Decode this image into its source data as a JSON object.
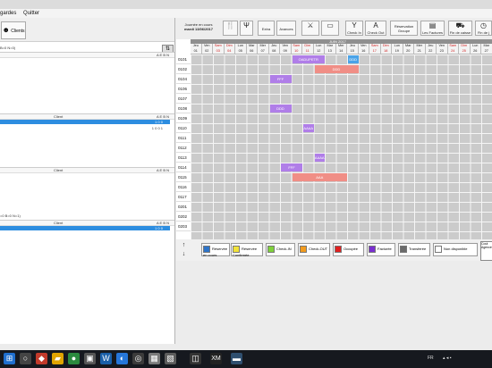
{
  "menu": {
    "items": [
      "gardes",
      "Quitter"
    ]
  },
  "left": {
    "client_button": "Clients",
    "toggle_icon": "swap-icon",
    "section1_label": "B=0 N=0)",
    "section_head_client": "Client",
    "section_head_flags": "A E B N",
    "sel_row_flags": "1 0 0",
    "plain_row_flags": "1 0 0 1",
    "section3_label": "=0 B=0 N=1)",
    "sel_row3_flags": "1 0 0"
  },
  "toolbar": {
    "day_title": "Journée en cours",
    "day_date": "mardi 13/06/2017",
    "extra": "Extra",
    "avances": "Avances",
    "check_in": "Check In",
    "check_out": "Check Out",
    "reservation_groupe": "Réservation Groupe",
    "les_factures": "Les Factures",
    "fin_caisse": "Fin de caisse",
    "fin_journee": "Fin de j"
  },
  "grid": {
    "month": "JUIN 2017",
    "days": [
      {
        "n": "Jeu",
        "d": "01",
        "we": false
      },
      {
        "n": "Ven",
        "d": "02",
        "we": false
      },
      {
        "n": "Sam",
        "d": "03",
        "we": true
      },
      {
        "n": "Dim",
        "d": "04",
        "we": true
      },
      {
        "n": "Lun",
        "d": "05",
        "we": false
      },
      {
        "n": "Mar",
        "d": "06",
        "we": false
      },
      {
        "n": "Mer",
        "d": "07",
        "we": false
      },
      {
        "n": "Jeu",
        "d": "08",
        "we": false
      },
      {
        "n": "Ven",
        "d": "09",
        "we": false
      },
      {
        "n": "Sam",
        "d": "10",
        "we": true
      },
      {
        "n": "Dim",
        "d": "11",
        "we": true
      },
      {
        "n": "Lun",
        "d": "12",
        "we": false
      },
      {
        "n": "Mar",
        "d": "13",
        "we": false
      },
      {
        "n": "Mer",
        "d": "14",
        "we": false
      },
      {
        "n": "Jeu",
        "d": "15",
        "we": false
      },
      {
        "n": "Ven",
        "d": "16",
        "we": false
      },
      {
        "n": "Sam",
        "d": "17",
        "we": true
      },
      {
        "n": "Dim",
        "d": "18",
        "we": true
      },
      {
        "n": "Lun",
        "d": "19",
        "we": false
      },
      {
        "n": "Mar",
        "d": "20",
        "we": false
      },
      {
        "n": "Mer",
        "d": "21",
        "we": false
      },
      {
        "n": "Jeu",
        "d": "22",
        "we": false
      },
      {
        "n": "Ven",
        "d": "23",
        "we": false
      },
      {
        "n": "Sam",
        "d": "24",
        "we": true
      },
      {
        "n": "Dim",
        "d": "25",
        "we": true
      },
      {
        "n": "Lun",
        "d": "26",
        "we": false
      },
      {
        "n": "Mar",
        "d": "27",
        "we": false
      }
    ],
    "rooms": [
      "0101",
      "0102",
      "0104",
      "0106",
      "0107",
      "0108",
      "0109",
      "0110",
      "0111",
      "0112",
      "0113",
      "0114",
      "0115",
      "0116",
      "0117",
      "0201",
      "0202",
      "0203"
    ],
    "reservations": [
      {
        "room": "0101",
        "start": "10",
        "end": "12",
        "label": "OADUPETR",
        "color": "#b07ee8"
      },
      {
        "room": "0101",
        "start": "15",
        "end": "15",
        "label": "DDD",
        "color": "#4aa3e8"
      },
      {
        "room": "0102",
        "start": "12",
        "end": "15",
        "label": "DDD",
        "color": "#f08e86"
      },
      {
        "room": "0104",
        "start": "08",
        "end": "09",
        "label": "FFF",
        "color": "#b07ee8"
      },
      {
        "room": "0108",
        "start": "08",
        "end": "09",
        "label": "DDD",
        "color": "#b07ee8"
      },
      {
        "room": "0110",
        "start": "11",
        "end": "11",
        "label": "AAAA",
        "color": "#b07ee8"
      },
      {
        "room": "0113",
        "start": "12",
        "end": "12",
        "label": "AAAA",
        "color": "#b07ee8"
      },
      {
        "room": "0114",
        "start": "09",
        "end": "10",
        "label": "FFF",
        "color": "#b07ee8"
      },
      {
        "room": "0115",
        "start": "10",
        "end": "14",
        "label": "AAA",
        "color": "#f08e86"
      }
    ]
  },
  "legend": {
    "items": [
      {
        "label": "Réservée en cours",
        "color": "#2e74c9"
      },
      {
        "label": "Réservée Confirmée",
        "color": "#f2e33a"
      },
      {
        "label": "Check-IN",
        "color": "#7fd13b"
      },
      {
        "label": "Check-OUT",
        "color": "#f29b1d"
      },
      {
        "label": "Occupée",
        "color": "#e02020"
      },
      {
        "label": "Facturée",
        "color": "#7a2fd0"
      },
      {
        "label": "Transferée",
        "color": "#6b6b6b"
      },
      {
        "label": "Non disponible",
        "color": "#ffffff"
      }
    ],
    "cout_label": "Cout Agence"
  },
  "taskbar": {
    "lang": "FR"
  }
}
